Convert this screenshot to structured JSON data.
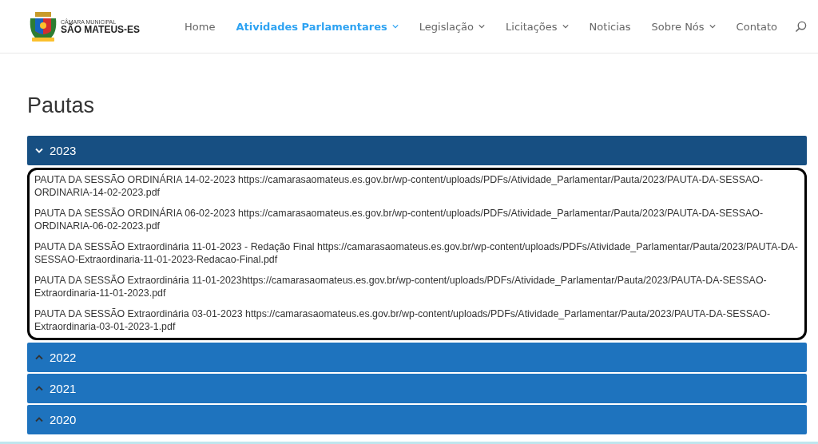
{
  "header": {
    "logo_top": "CÂMARA MUNICIPAL",
    "logo_name": "SÃO MATEUS-ES",
    "nav": [
      {
        "label": "Home",
        "selected": false,
        "dropdown": false
      },
      {
        "label": "Atividades Parlamentares",
        "selected": true,
        "dropdown": true
      },
      {
        "label": "Legislação",
        "selected": false,
        "dropdown": true
      },
      {
        "label": "Licitações",
        "selected": false,
        "dropdown": true
      },
      {
        "label": "Noticias",
        "selected": false,
        "dropdown": false
      },
      {
        "label": "Sobre Nós",
        "selected": false,
        "dropdown": true
      },
      {
        "label": "Contato",
        "selected": false,
        "dropdown": false
      }
    ]
  },
  "page_title": "Pautas",
  "accordion": [
    {
      "label": "2023",
      "expanded": true,
      "items": [
        "PAUTA DA SESSÃO ORDINÁRIA 14-02-2023 https://camarasaomateus.es.gov.br/wp-content/uploads/PDFs/Atividade_Parlamentar/Pauta/2023/PAUTA-DA-SESSAO-ORDINARIA-14-02-2023.pdf",
        "PAUTA DA SESSÃO ORDINÁRIA 06-02-2023 https://camarasaomateus.es.gov.br/wp-content/uploads/PDFs/Atividade_Parlamentar/Pauta/2023/PAUTA-DA-SESSAO-ORDINARIA-06-02-2023.pdf",
        "PAUTA DA SESSÃO Extraordinária 11-01-2023 - Redação Final https://camarasaomateus.es.gov.br/wp-content/uploads/PDFs/Atividade_Parlamentar/Pauta/2023/PAUTA-DA-SESSAO-Extraordinaria-11-01-2023-Redacao-Final.pdf",
        "PAUTA DA SESSÃO Extraordinária 11-01-2023https://camarasaomateus.es.gov.br/wp-content/uploads/PDFs/Atividade_Parlamentar/Pauta/2023/PAUTA-DA-SESSAO-Extraordinaria-11-01-2023.pdf",
        "PAUTA DA SESSÃO Extraordinária 03-01-2023 https://camarasaomateus.es.gov.br/wp-content/uploads/PDFs/Atividade_Parlamentar/Pauta/2023/PAUTA-DA-SESSAO-Extraordinaria-03-01-2023-1.pdf"
      ]
    },
    {
      "label": "2022",
      "expanded": false
    },
    {
      "label": "2021",
      "expanded": false
    },
    {
      "label": "2020",
      "expanded": false
    }
  ]
}
